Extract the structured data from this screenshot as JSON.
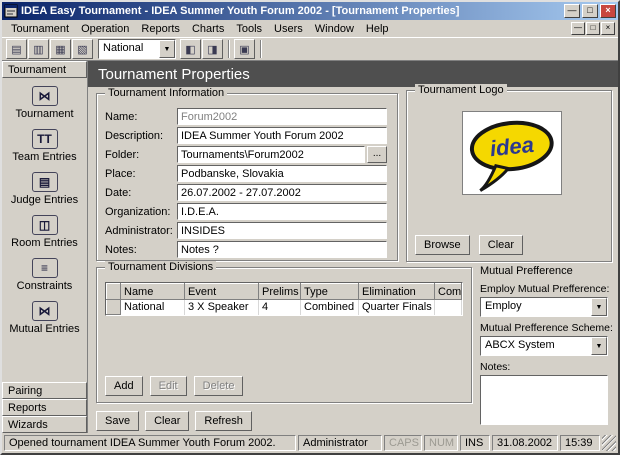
{
  "titlebar": {
    "title": "IDEA Easy Tournament - IDEA Summer Youth Forum 2002 - [Tournament Properties]"
  },
  "window_controls": {
    "minimize": "—",
    "maximize": "□",
    "close": "×"
  },
  "menubar": {
    "items": [
      "Tournament",
      "Operation",
      "Reports",
      "Charts",
      "Tools",
      "Users",
      "Window",
      "Help"
    ]
  },
  "toolbar": {
    "combo_value": "National",
    "icons": [
      {
        "name": "toolbar-icon-1",
        "glyph": "▤"
      },
      {
        "name": "toolbar-icon-2",
        "glyph": "▥"
      },
      {
        "name": "toolbar-icon-3",
        "glyph": "▦"
      },
      {
        "name": "toolbar-icon-4",
        "glyph": "▧"
      },
      {
        "name": "toolbar-icon-5",
        "glyph": "◧"
      },
      {
        "name": "toolbar-icon-6",
        "glyph": "◨"
      },
      {
        "name": "toolbar-icon-7",
        "glyph": "▣"
      }
    ]
  },
  "glyphs": {
    "dropdown": "▼",
    "ellipsis": "..."
  },
  "sidebar": {
    "header": "Tournament",
    "items": [
      {
        "label": "Tournament",
        "icon": "tournament-icon",
        "glyph": "⋈"
      },
      {
        "label": "Team Entries",
        "icon": "team-entries-icon",
        "glyph": "TT"
      },
      {
        "label": "Judge Entries",
        "icon": "judge-entries-icon",
        "glyph": "▤"
      },
      {
        "label": "Room Entries",
        "icon": "room-entries-icon",
        "glyph": "◫"
      },
      {
        "label": "Constraints",
        "icon": "constraints-icon",
        "glyph": "≡"
      },
      {
        "label": "Mutual Entries",
        "icon": "mutual-entries-icon",
        "glyph": "⋈"
      }
    ],
    "bars": [
      "Pairing",
      "Reports",
      "Wizards"
    ]
  },
  "page": {
    "title": "Tournament Properties"
  },
  "info": {
    "legend": "Tournament Information",
    "fields": [
      {
        "label": "Name:",
        "value": "Forum2002"
      },
      {
        "label": "Description:",
        "value": "IDEA Summer Youth Forum 2002"
      },
      {
        "label": "Folder:",
        "value": "Tournaments\\Forum2002"
      },
      {
        "label": "Place:",
        "value": "Podbanske, Slovakia"
      },
      {
        "label": "Date:",
        "value": "26.07.2002 - 27.07.2002"
      },
      {
        "label": "Organization:",
        "value": "I.D.E.A."
      },
      {
        "label": "Administrator:",
        "value": "INSIDES"
      },
      {
        "label": "Notes:",
        "value": "Notes ?"
      }
    ]
  },
  "logo": {
    "legend": "Tournament Logo",
    "logo_text": "idea",
    "browse": "Browse",
    "clear": "Clear",
    "colors": {
      "bubble": "#f5d800",
      "outline": "#161616",
      "text": "#2b3990"
    }
  },
  "divisions": {
    "legend": "Tournament Divisions",
    "columns": [
      "Name",
      "Event",
      "Prelims",
      "Type",
      "Elimination",
      "Comment"
    ],
    "rows": [
      [
        "National",
        "3 X Speaker",
        "4",
        "Combined",
        "Quarter Finals",
        ""
      ]
    ],
    "buttons": {
      "add": "Add",
      "edit": "Edit",
      "delete": "Delete"
    }
  },
  "mutual": {
    "title": "Mutual Prefference",
    "employ_label": "Employ Mutual Prefference:",
    "employ_value": "Employ",
    "scheme_label": "Mutual Prefference Scheme:",
    "scheme_value": "ABCX System",
    "notes_label": "Notes:"
  },
  "actions": {
    "save": "Save",
    "clear": "Clear",
    "refresh": "Refresh"
  },
  "statusbar": {
    "message": "Opened tournament IDEA Summer Youth Forum 2002.",
    "user": "Administrator",
    "caps": "CAPS",
    "num": "NUM",
    "ins": "INS",
    "date": "31.08.2002",
    "time": "15:39"
  },
  "colors": {
    "titlebar_start": "#0a246a",
    "titlebar_end": "#a6caf0",
    "page_header_bg": "#4f4f4f",
    "window_bg": "#d4d0c8",
    "close_button": "#c8473f"
  }
}
